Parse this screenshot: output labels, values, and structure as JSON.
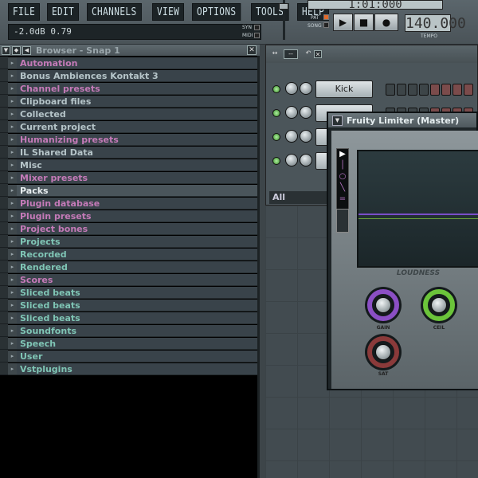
{
  "menubar": {
    "items": [
      "FILE",
      "EDIT",
      "CHANNELS",
      "VIEW",
      "OPTIONS",
      "TOOLS",
      "HELP"
    ]
  },
  "hint": {
    "text": "-2.0dB  0.79"
  },
  "topbar": {
    "syn_label": "SYN",
    "midi_label": "MIDI",
    "pat_label": "PAT",
    "song_label": "SONG",
    "tempo_value": "140.000",
    "tempo_label": "TEMPO",
    "time_value": "1:01:000"
  },
  "transport": {
    "play": "▶",
    "stop": "■",
    "record": "●"
  },
  "browser": {
    "title": "Browser - Snap 1",
    "items": [
      {
        "label": "Automation",
        "color": "pink"
      },
      {
        "label": "Bonus Ambiences Kontakt 3",
        "color": "gray"
      },
      {
        "label": "Channel presets",
        "color": "pink"
      },
      {
        "label": "Clipboard files",
        "color": "gray"
      },
      {
        "label": "Collected",
        "color": "gray"
      },
      {
        "label": "Current project",
        "color": "gray"
      },
      {
        "label": "Humanizing presets",
        "color": "pink"
      },
      {
        "label": "IL Shared Data",
        "color": "gray"
      },
      {
        "label": "Misc",
        "color": "gray"
      },
      {
        "label": "Mixer presets",
        "color": "pink"
      },
      {
        "label": "Packs",
        "color": "gray"
      },
      {
        "label": "Plugin database",
        "color": "pink"
      },
      {
        "label": "Plugin presets",
        "color": "pink"
      },
      {
        "label": "Project bones",
        "color": "pink"
      },
      {
        "label": "Projects",
        "color": "teal"
      },
      {
        "label": "Recorded",
        "color": "teal"
      },
      {
        "label": "Rendered",
        "color": "teal"
      },
      {
        "label": "Scores",
        "color": "pink"
      },
      {
        "label": "Sliced beats",
        "color": "teal"
      },
      {
        "label": "Sliced beats",
        "color": "teal"
      },
      {
        "label": "Sliced beats",
        "color": "teal"
      },
      {
        "label": "Soundfonts",
        "color": "teal"
      },
      {
        "label": "Speech",
        "color": "teal"
      },
      {
        "label": "User",
        "color": "teal"
      },
      {
        "label": "Vstplugins",
        "color": "teal"
      }
    ],
    "selected_index": 10
  },
  "channel_rack": {
    "channels": [
      {
        "name": "Kick"
      },
      {
        "name": ""
      },
      {
        "name": ""
      },
      {
        "name": ""
      }
    ],
    "filter_label": "All"
  },
  "limiter": {
    "title": "Fruity Limiter (Master)",
    "section_label": "LOUDNESS",
    "knobs": [
      {
        "label": "GAIN",
        "color": "#8b4fc4"
      },
      {
        "label": "CEIL",
        "color": "#6bc43a"
      },
      {
        "label": "SAT",
        "color": "#8a3a3a"
      }
    ]
  },
  "colors": {
    "pink": "#c47ab8",
    "teal": "#7fc5b5",
    "gray": "#b5c4c8"
  }
}
